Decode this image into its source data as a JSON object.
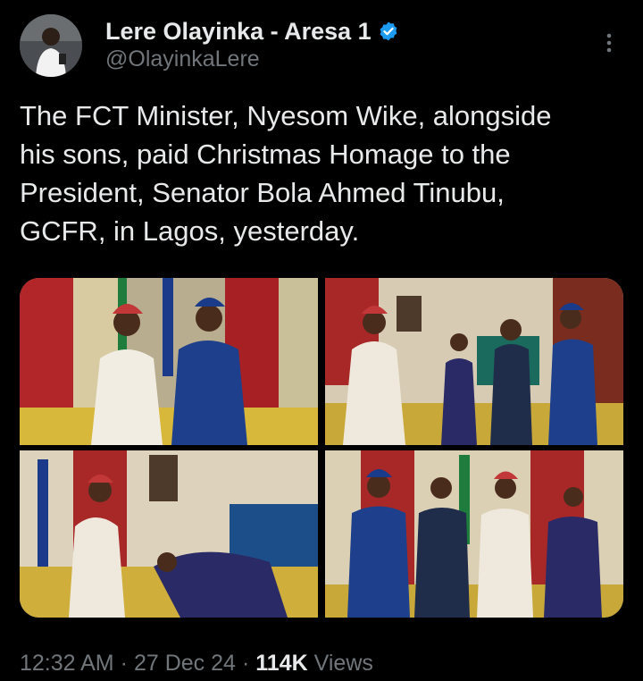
{
  "author": {
    "display_name": "Lere Olayinka - Aresa 1",
    "handle": "@OlayinkaLere",
    "verified": true,
    "icons": {
      "verified": "verified-badge-icon",
      "more": "more-options-icon"
    },
    "colors": {
      "verified": "#1d9bf0"
    }
  },
  "tweet": {
    "text": "The FCT Minister, Nyesom Wike, alongside\nhis sons, paid Christmas Homage to the\nPresident, Senator Bola Ahmed Tinubu,\nGCFR, in Lagos, yesterday."
  },
  "media": {
    "count": 4,
    "photos": [
      "photo-1",
      "photo-2",
      "photo-3",
      "photo-4"
    ]
  },
  "meta": {
    "time": "12:32 AM",
    "separator": "·",
    "date": "27 Dec 24",
    "views_count": "114K",
    "views_label": "Views"
  },
  "colors": {
    "background": "#000000",
    "text_primary": "#e7e9ea",
    "text_secondary": "#71767b"
  }
}
